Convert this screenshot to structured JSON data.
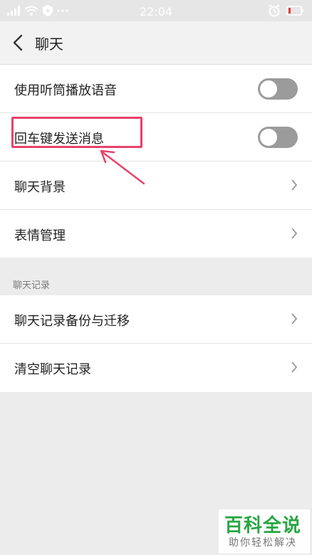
{
  "status_bar": {
    "time": "22:04"
  },
  "header": {
    "title": "聊天"
  },
  "settings": {
    "items": [
      {
        "label": "使用听筒播放语音",
        "control": "toggle",
        "on": false
      },
      {
        "label": "回车键发送消息",
        "control": "toggle",
        "on": false
      },
      {
        "label": "聊天背景",
        "control": "chevron"
      },
      {
        "label": "表情管理",
        "control": "chevron"
      }
    ]
  },
  "history_section": {
    "label": "聊天记录",
    "items": [
      {
        "label": "聊天记录备份与迁移",
        "control": "chevron"
      },
      {
        "label": "清空聊天记录",
        "control": "chevron"
      }
    ]
  },
  "annotation": {
    "color": "#e8426b"
  },
  "watermark": {
    "main": "百科全说",
    "sub": "助你轻松解决",
    "color": "#2aa644"
  }
}
